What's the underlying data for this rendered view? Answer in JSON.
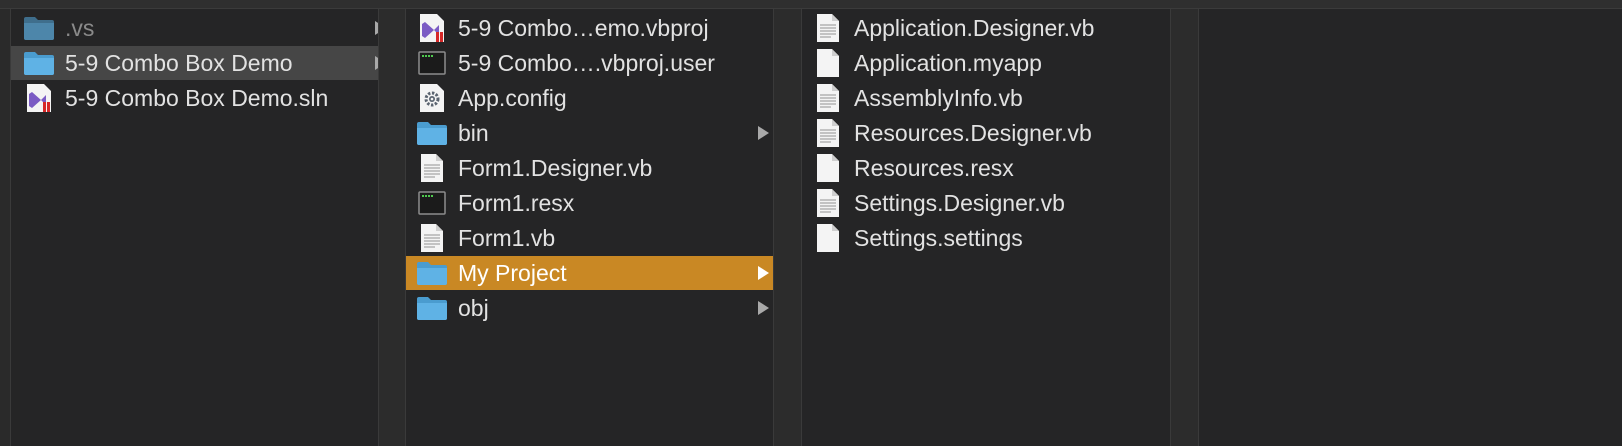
{
  "columns": [
    {
      "items": [
        {
          "label": ".vs",
          "icon": "folder-icon",
          "arrow": true,
          "state": "dim"
        },
        {
          "label": "5-9 Combo Box Demo",
          "icon": "folder-icon",
          "arrow": true,
          "state": "selected-inactive"
        },
        {
          "label": "5-9 Combo Box Demo.sln",
          "icon": "visual-studio-solution-icon",
          "arrow": false,
          "state": "normal"
        }
      ]
    },
    {
      "items": [
        {
          "label": "5-9 Combo…emo.vbproj",
          "icon": "visual-studio-project-icon",
          "arrow": false,
          "state": "normal"
        },
        {
          "label": "5-9 Combo….vbproj.user",
          "icon": "terminal-file-icon",
          "arrow": false,
          "state": "normal"
        },
        {
          "label": "App.config",
          "icon": "config-gear-icon",
          "arrow": false,
          "state": "normal"
        },
        {
          "label": "bin",
          "icon": "folder-icon",
          "arrow": true,
          "state": "normal"
        },
        {
          "label": "Form1.Designer.vb",
          "icon": "text-document-icon",
          "arrow": false,
          "state": "normal"
        },
        {
          "label": "Form1.resx",
          "icon": "terminal-file-icon",
          "arrow": false,
          "state": "normal"
        },
        {
          "label": "Form1.vb",
          "icon": "text-document-icon",
          "arrow": false,
          "state": "normal"
        },
        {
          "label": "My Project",
          "icon": "folder-icon",
          "arrow": true,
          "state": "selected"
        },
        {
          "label": "obj",
          "icon": "folder-icon",
          "arrow": true,
          "state": "normal"
        }
      ]
    },
    {
      "items": [
        {
          "label": "Application.Designer.vb",
          "icon": "text-document-icon",
          "arrow": false,
          "state": "normal"
        },
        {
          "label": "Application.myapp",
          "icon": "blank-document-icon",
          "arrow": false,
          "state": "normal"
        },
        {
          "label": "AssemblyInfo.vb",
          "icon": "text-document-icon",
          "arrow": false,
          "state": "normal"
        },
        {
          "label": "Resources.Designer.vb",
          "icon": "text-document-icon",
          "arrow": false,
          "state": "normal"
        },
        {
          "label": "Resources.resx",
          "icon": "blank-document-icon",
          "arrow": false,
          "state": "normal"
        },
        {
          "label": "Settings.Designer.vb",
          "icon": "text-document-icon",
          "arrow": false,
          "state": "normal"
        },
        {
          "label": "Settings.settings",
          "icon": "blank-document-icon",
          "arrow": false,
          "state": "normal"
        }
      ]
    }
  ],
  "colors": {
    "selection": "#c98824",
    "inactive_selection": "#464646",
    "folder": "#5fb2e5",
    "background": "#252526"
  }
}
